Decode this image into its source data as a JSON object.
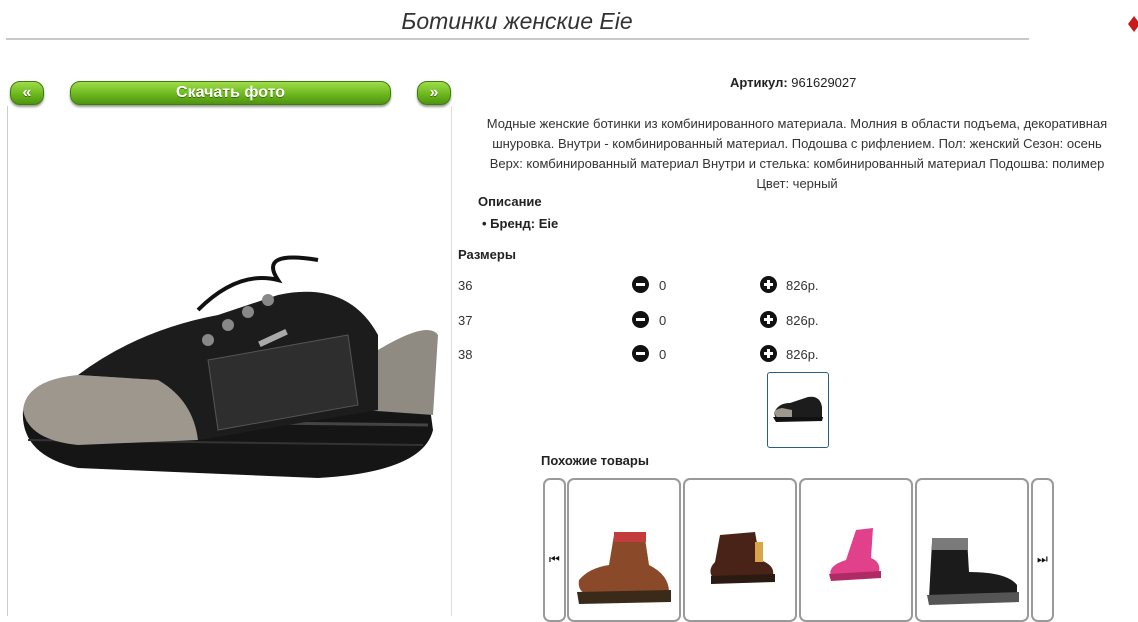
{
  "page": {
    "title": "Ботинки женские Eie"
  },
  "nav": {
    "prev_label": "«",
    "download_label": "Скачать фото",
    "next_label": "»"
  },
  "product": {
    "artikul_label": "Артикул:",
    "artikul_value": "961629027",
    "description_lines": [
      "Модные женские ботинки из комбинированного материала. Молния в области подъема, декоративная",
      "шнуровка. Внутри - комбинированный материал. Подошва с рифлением. Пол: женский Сезон: осень",
      "Верх: комбинированный материал Внутри и стелька: комбинированный материал Подошва: полимер",
      "Цвет: черный"
    ],
    "opisanie_heading": "Описание",
    "brand_line": "Бренд: Eie"
  },
  "sizes": {
    "heading": "Размеры",
    "rows": [
      {
        "size": "36",
        "qty": "0",
        "price": "826р."
      },
      {
        "size": "37",
        "qty": "0",
        "price": "826р."
      },
      {
        "size": "38",
        "qty": "0",
        "price": "826р."
      }
    ]
  },
  "similar": {
    "heading": "Похожие товары",
    "prev_icon": "skip-previous-icon",
    "next_icon": "skip-next-icon",
    "items": [
      {
        "name": "brown-hiking-boot-image"
      },
      {
        "name": "dark-brown-kids-boot-image"
      },
      {
        "name": "pink-sneaker-image"
      },
      {
        "name": "black-winter-boot-image"
      }
    ]
  },
  "colors": {
    "button_green": "#6cb81e",
    "thumb_border": "#2a5d87",
    "accent_red": "#cc1a1a"
  }
}
